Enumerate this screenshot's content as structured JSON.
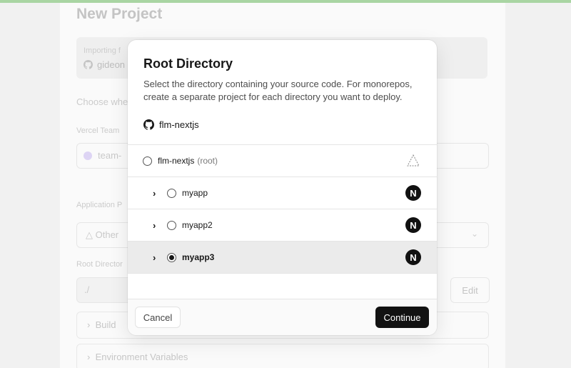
{
  "background": {
    "title": "New Project",
    "import_label": "Importing f",
    "import_repo": "gideon",
    "choose_text": "Choose whe",
    "team_label": "Vercel Team",
    "team_value": "team-",
    "app_preset_label": "Application P",
    "app_preset_value": "Other",
    "root_label": "Root Director",
    "root_value": "./",
    "edit_label": "Edit",
    "build_label": "Build",
    "env_label": "Environment Variables"
  },
  "modal": {
    "title": "Root Directory",
    "description": "Select the directory containing your source code. For monorepos, create a separate project for each directory you want to deploy.",
    "repo_name": "flm-nextjs",
    "items": [
      {
        "label": "flm-nextjs",
        "suffix": "(root)",
        "framework": "other",
        "selected": false
      },
      {
        "label": "myapp",
        "framework": "nextjs",
        "selected": false
      },
      {
        "label": "myapp2",
        "framework": "nextjs",
        "selected": false
      },
      {
        "label": "myapp3",
        "framework": "nextjs",
        "selected": true
      }
    ],
    "next_icon_glyph": "N",
    "cancel_label": "Cancel",
    "continue_label": "Continue"
  }
}
